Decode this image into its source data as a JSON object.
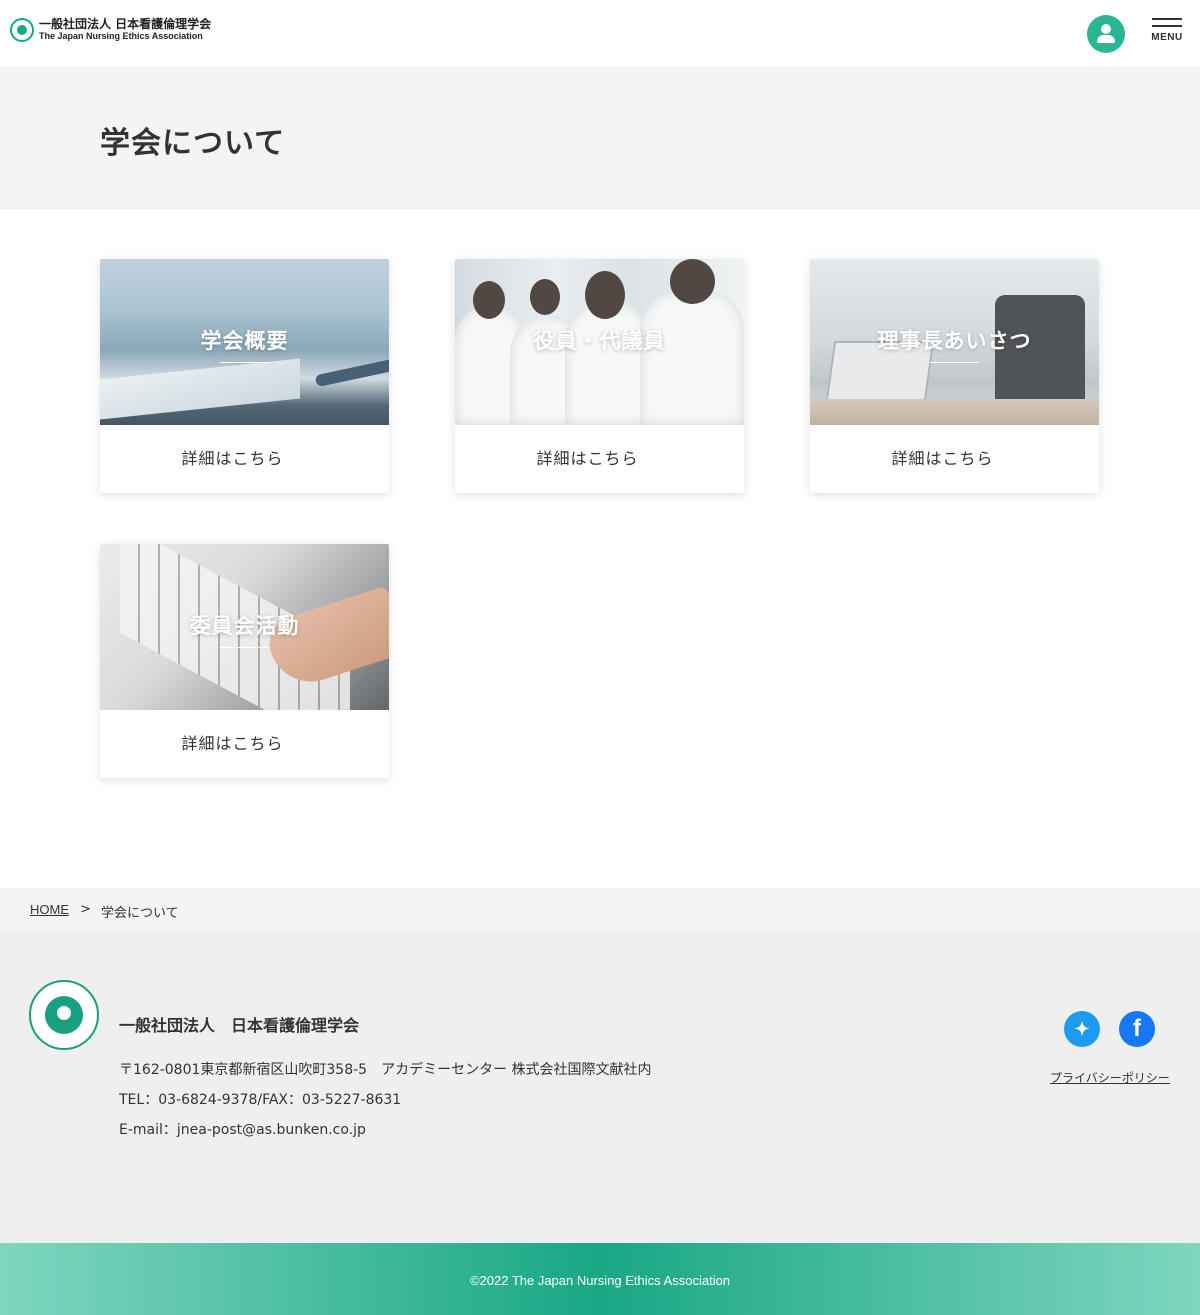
{
  "header": {
    "logo_jp": "一般社団法人 日本看護倫理学会",
    "logo_en": "The Japan Nursing Ethics Association",
    "menu_label": "MENU"
  },
  "page": {
    "title": "学会について"
  },
  "cards": [
    {
      "title": "学会概要",
      "link": "詳細はこちら"
    },
    {
      "title": "役員・代議員",
      "link": "詳細はこちら"
    },
    {
      "title": "理事長あいさつ",
      "link": "詳細はこちら"
    },
    {
      "title": "委員会活動",
      "link": "詳細はこちら"
    }
  ],
  "breadcrumb": {
    "home": "HOME",
    "separator": ">",
    "current": "学会について"
  },
  "footer": {
    "org_name": "一般社団法人　日本看護倫理学会",
    "address": "〒162-0801東京都新宿区山吹町358-5　アカデミーセンター 株式会社国際文献社内",
    "tel": "TEL：03-6824-9378/FAX：03-5227-8631",
    "email": "E-mail：jnea-post@as.bunken.co.jp",
    "privacy_link": "プライバシーポリシー",
    "copyright": "©2022 The Japan Nursing Ethics Association"
  },
  "colors": {
    "accent": "#19a785",
    "twitter": "#1d9bf0",
    "facebook": "#1877f2"
  },
  "icons": [
    "logo-mark",
    "user-icon",
    "menu-icon",
    "twitter-icon",
    "facebook-icon"
  ]
}
